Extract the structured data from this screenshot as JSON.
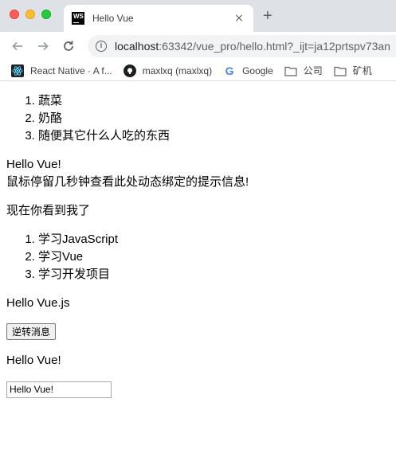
{
  "browser": {
    "tab_title": "Hello Vue",
    "tab_close": "×",
    "new_tab": "+",
    "url_host": "localhost",
    "url_path": ":63342/vue_pro/hello.html?_ijt=ja12prtspv73an",
    "bookmarks": [
      {
        "label": "React Native · A f...",
        "icon": "react-icon"
      },
      {
        "label": "maxlxq (maxlxq)",
        "icon": "github-icon"
      },
      {
        "label": "Google",
        "icon": "google-icon"
      },
      {
        "label": "公司",
        "icon": "folder-icon"
      },
      {
        "label": "矿机",
        "icon": "folder-icon"
      }
    ]
  },
  "page": {
    "list1": [
      "蔬菜",
      "奶酪",
      "随便其它什么人吃的东西"
    ],
    "hello_text": "Hello Vue!",
    "tooltip_text": "鼠标停留几秒钟查看此处动态绑定的提示信息!",
    "visible_text": "现在你看到我了",
    "list2": [
      "学习JavaScript",
      "学习Vue",
      "学习开发项目"
    ],
    "hello_vuejs": "Hello Vue.js",
    "reverse_button": "逆转消息",
    "model_text": "Hello Vue!",
    "input_value": "Hello Vue!"
  }
}
